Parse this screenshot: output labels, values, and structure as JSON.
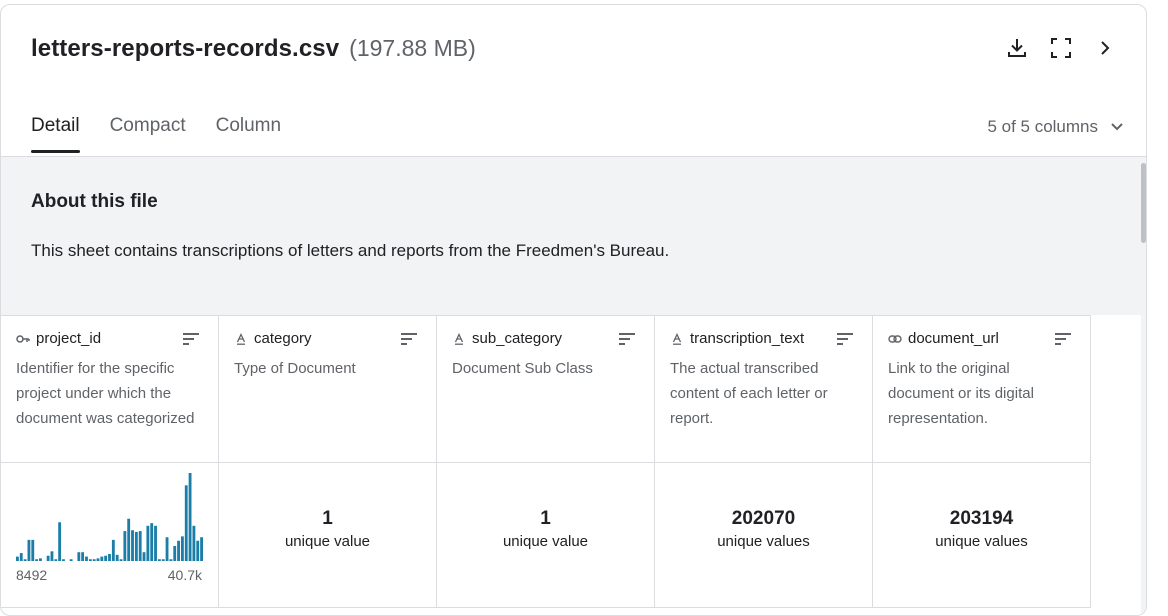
{
  "file": {
    "name": "letters-reports-records.csv",
    "size": "(197.88 MB)"
  },
  "actions": {
    "download_icon": "download-icon",
    "fullscreen_icon": "fullscreen-icon",
    "next_icon": "chevron-right-icon"
  },
  "tabs": [
    {
      "label": "Detail",
      "active": true
    },
    {
      "label": "Compact",
      "active": false
    },
    {
      "label": "Column",
      "active": false
    }
  ],
  "column_selector": {
    "label": "5 of 5 columns"
  },
  "about": {
    "title": "About this file",
    "text": "This sheet contains transcriptions of letters and reports from the Freedmen's Bureau."
  },
  "columns": [
    {
      "name": "project_id",
      "type_icon": "id-key-icon",
      "description": "Identifier for the specific project under which the document was categorized"
    },
    {
      "name": "category",
      "type_icon": "text-type-icon",
      "description": "Type of Document",
      "stat_value": "1",
      "stat_label": "unique value"
    },
    {
      "name": "sub_category",
      "type_icon": "text-type-icon",
      "description": "Document Sub Class",
      "stat_value": "1",
      "stat_label": "unique value"
    },
    {
      "name": "transcription_text",
      "type_icon": "text-type-icon",
      "description": "The actual transcribed content of each letter or report.",
      "stat_value": "202070",
      "stat_label": "unique values"
    },
    {
      "name": "document_url",
      "type_icon": "link-icon",
      "description": "Link to the original document or its digital representation.",
      "stat_value": "203194",
      "stat_label": "unique values"
    }
  ],
  "chart_data": {
    "type": "bar",
    "min_label": "8492",
    "max_label": "40.7k",
    "values": [
      5,
      9,
      2,
      24,
      24,
      2,
      3,
      0,
      6,
      11,
      2,
      44,
      2,
      0,
      2,
      0,
      10,
      10,
      5,
      2,
      2,
      3,
      5,
      6,
      8,
      24,
      7,
      2,
      34,
      48,
      35,
      33,
      34,
      10,
      40,
      43,
      40,
      2,
      2,
      27,
      2,
      17,
      23,
      28,
      86,
      100,
      40,
      23,
      27
    ]
  }
}
